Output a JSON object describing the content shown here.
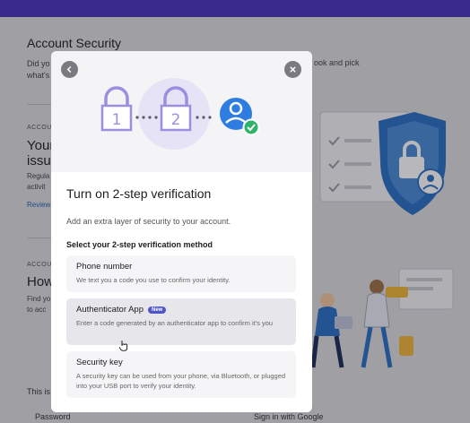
{
  "background": {
    "title": "Account Security",
    "desc_left": "Did yo\nwhat's",
    "desc_right": "ook and pick",
    "section1": {
      "label": "ACCOU",
      "heading": "Your\nissue",
      "text": "Regula\nactivit",
      "link": "Review"
    },
    "section2": {
      "label": "ACCOU",
      "heading": "How",
      "text": "Find yo\nto acc"
    },
    "footer_note": "This is",
    "footer_password": "Password",
    "footer_google": "Sign in with Google"
  },
  "modal": {
    "back_icon": "chevron-left-icon",
    "close_icon": "close-icon",
    "hero": {
      "step1": "1",
      "step2": "2"
    },
    "title": "Turn on 2-step verification",
    "subtitle": "Add an extra layer of security to your account.",
    "section_label": "Select your 2-step verification method",
    "options": [
      {
        "title": "Phone number",
        "desc": "We text you a code you use to confirm your identity."
      },
      {
        "title": "Authenticator App",
        "badge": "New",
        "desc": "Enter a code generated by an authenticator app to confirm it's you"
      },
      {
        "title": "Security key",
        "desc": "A security key can be used from your phone, via Bluetooth, or plugged into your USB port to verify your identity."
      }
    ]
  },
  "colors": {
    "topbar": "#3a2a8c",
    "lock_purple": "#9b8fe0",
    "avatar_blue": "#2f7de1",
    "check_green": "#2fb36a",
    "badge_blue": "#4d55c8"
  }
}
